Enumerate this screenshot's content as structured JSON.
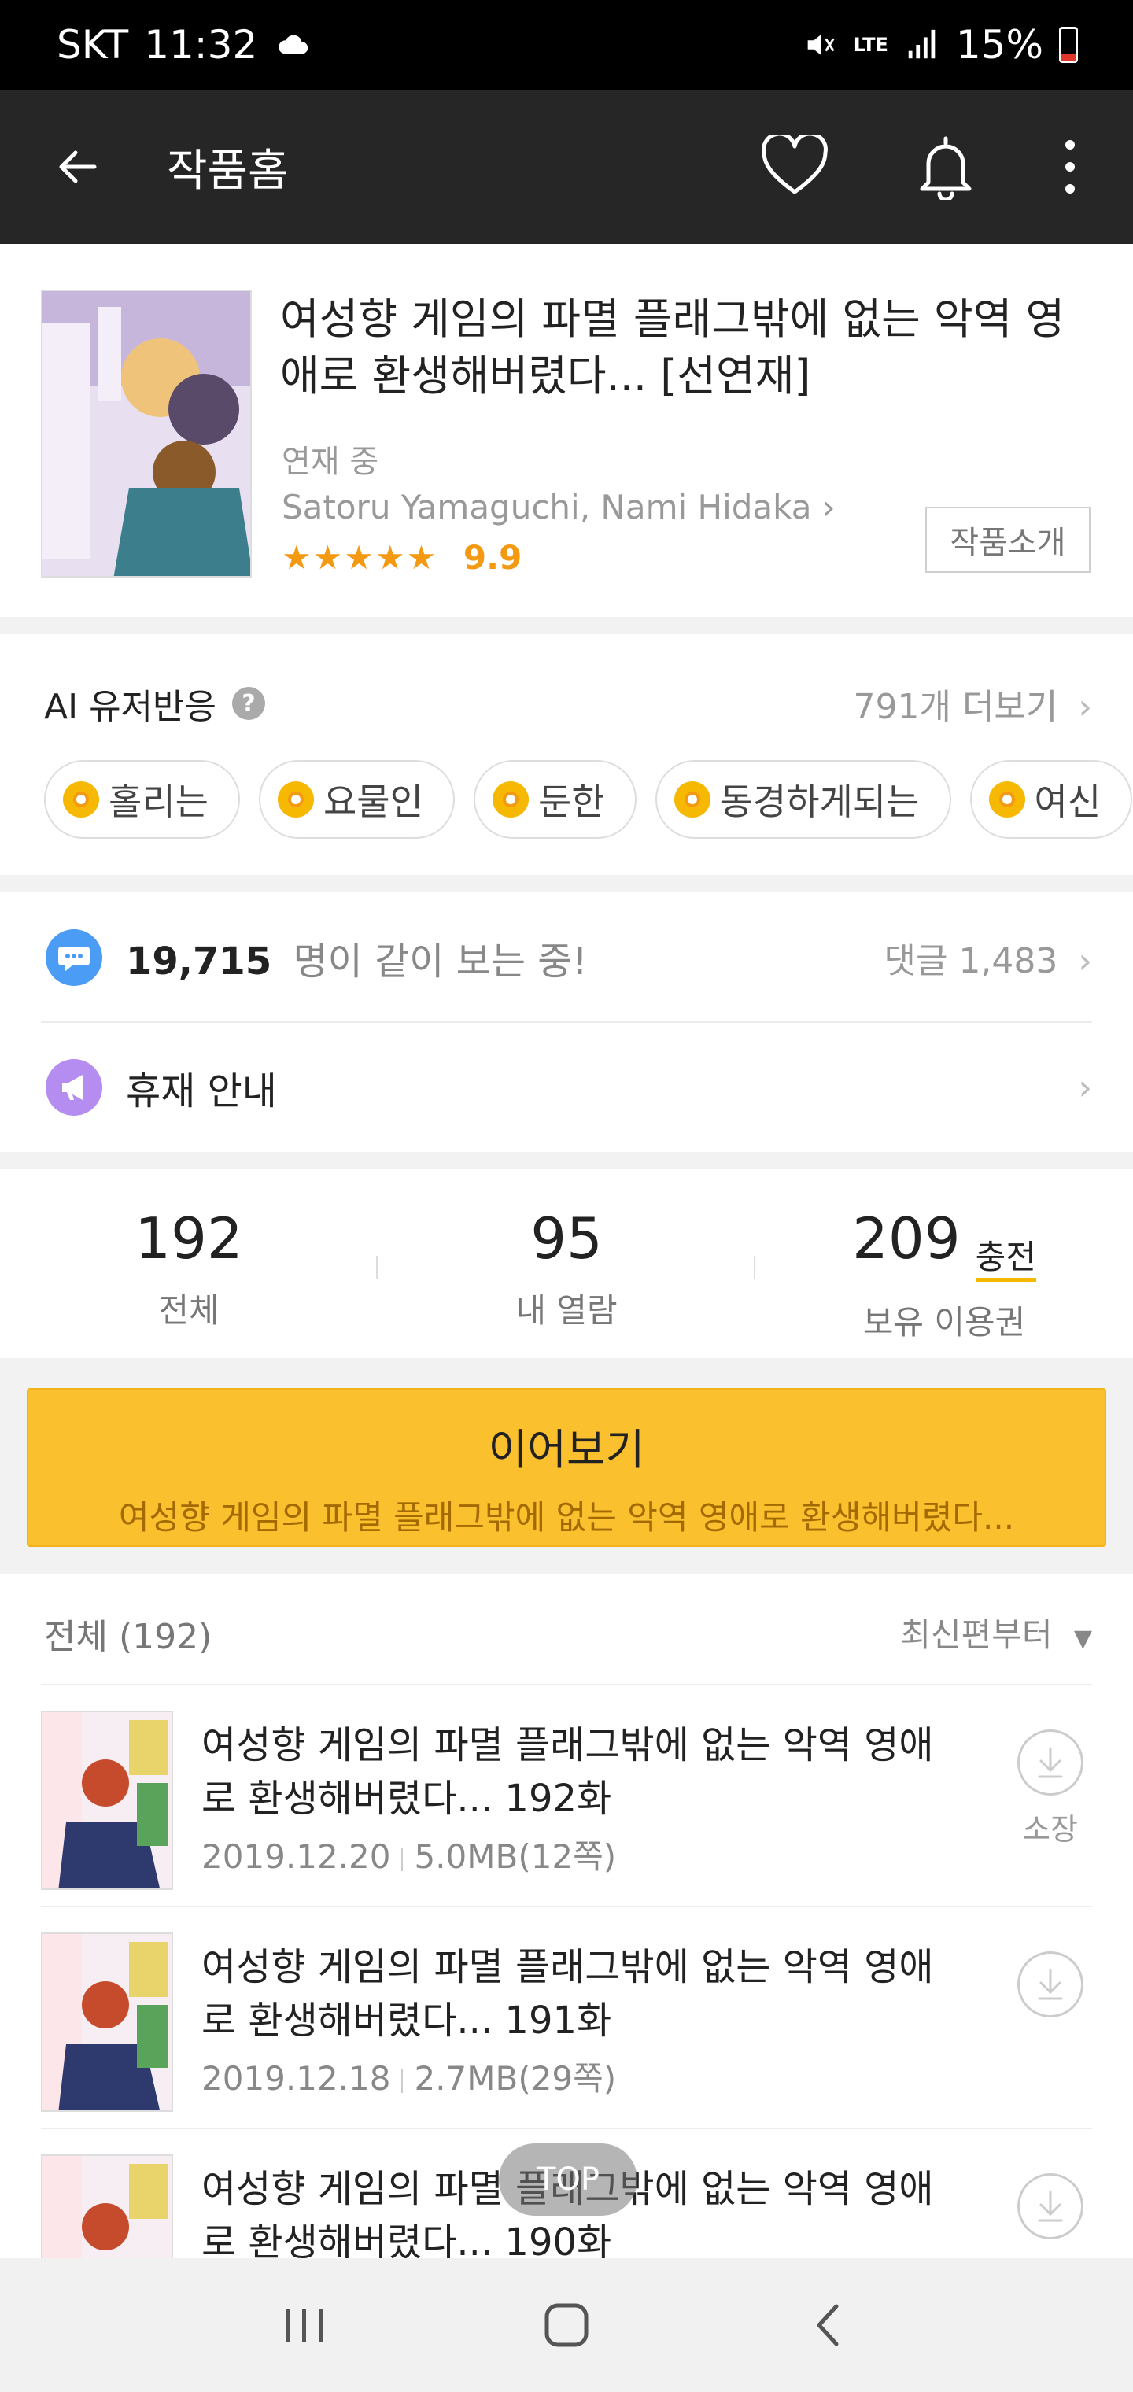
{
  "status_bar": {
    "carrier": "SKT",
    "time": "11:32",
    "network": "LTE",
    "battery": "15%",
    "icons": [
      "cloud-icon",
      "mute-icon",
      "lte-icon",
      "signal-icon",
      "battery-icon"
    ]
  },
  "app_bar": {
    "title": "작품홈",
    "icons": [
      "back-arrow-icon",
      "heart-icon",
      "bell-icon",
      "more-vert-icon"
    ]
  },
  "work": {
    "title": "여성향 게임의 파멸 플래그밖에 없는 악역 영애로 환생해버렸다... [선연재]",
    "status": "연재 중",
    "author": "Satoru Yamaguchi, Nami Hidaka",
    "author_chevron": "›",
    "stars": "★★★★★",
    "rating": "9.9",
    "intro_button": "작품소개"
  },
  "ai_reaction": {
    "title": "AI 유저반응",
    "help": "?",
    "more": "791개 더보기",
    "more_chevron": "›",
    "chips": [
      "홀리는",
      "요물인",
      "둔한",
      "동경하게되는",
      "여신"
    ]
  },
  "watching": {
    "count": "19,715",
    "suffix": "명이 같이 보는 중!",
    "comments": "댓글 1,483",
    "chevron": "›"
  },
  "notice": {
    "label": "휴재 안내",
    "chevron": "›"
  },
  "stats": {
    "total_value": "192",
    "total_label": "전체",
    "read_value": "95",
    "read_label": "내 열람",
    "tickets_value": "209",
    "tickets_label": "보유 이용권",
    "charge": "충전"
  },
  "continue": {
    "label": "이어보기",
    "subtitle": "여성향 게임의 파멸 플래그밖에 없는 악역 영애로 환생해버렸다..."
  },
  "list": {
    "header": "전체 (192)",
    "sort": "최신편부터",
    "sort_caret": "▼",
    "float_button": "TOP",
    "download_label": "소장",
    "episodes": [
      {
        "title": "여성향 게임의 파멸 플래그밖에 없는 악역 영애로 환생해버렸다... 192화",
        "date": "2019.12.20",
        "size": "5.0MB(12쪽)"
      },
      {
        "title": "여성향 게임의 파멸 플래그밖에 없는 악역 영애로 환생해버렸다... 191화",
        "date": "2019.12.18",
        "size": "2.7MB(29쪽)"
      },
      {
        "title": "여성향 게임의 파멸 플래그밖에 없는 악역 영애로 환생해버렸다... 190화",
        "date": "",
        "size": ""
      }
    ]
  },
  "nav_bar": {
    "icons": [
      "recent-apps-icon",
      "home-icon",
      "back-icon"
    ]
  },
  "colors": {
    "accent_yellow": "#fbc02d",
    "rating_orange": "#f39a12",
    "app_bar_bg": "#262626",
    "chat_icon_blue": "#4a9cf5",
    "notice_icon_purple": "#b58cf0"
  }
}
